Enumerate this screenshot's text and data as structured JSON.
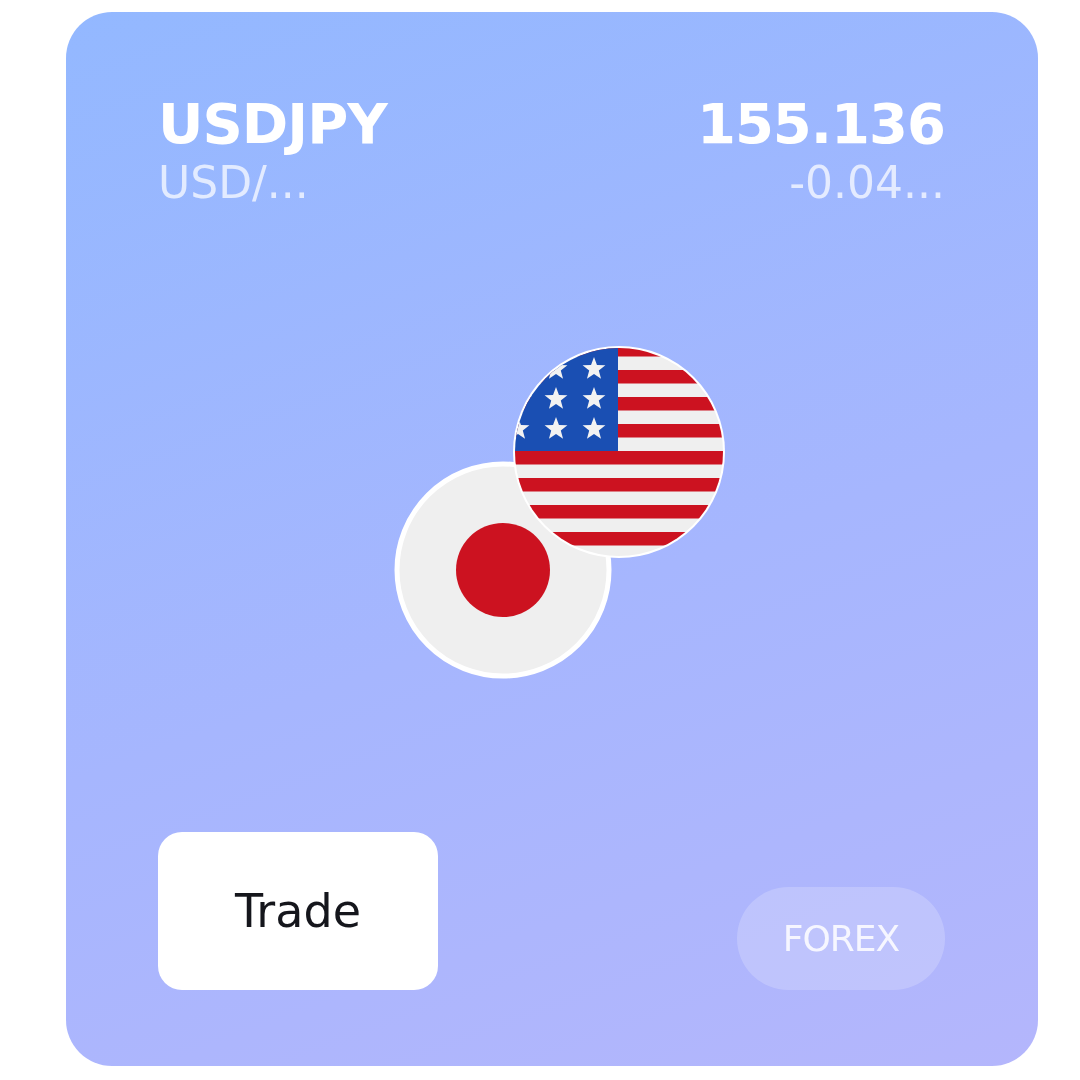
{
  "instrument": {
    "symbol": "USDJPY",
    "name": "USD/...",
    "price": "155.136",
    "change": "-0.04..."
  },
  "actions": {
    "trade_button": "Trade",
    "category": "FOREX"
  }
}
